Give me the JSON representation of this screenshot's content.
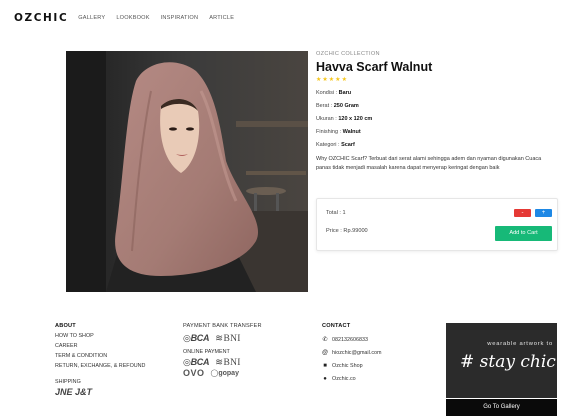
{
  "nav": {
    "logo": "OZCHIC",
    "links": [
      "GALLERY",
      "LOOKBOOK",
      "INSPIRATION",
      "ARTICLE"
    ]
  },
  "product": {
    "collection": "OZCHIC COLLECTION",
    "title": "Havva Scarf Walnut",
    "rating": 5,
    "attributes": [
      {
        "label": "Kondisi : ",
        "value": "Baru"
      },
      {
        "label": "Berat : ",
        "value": "250 Gram"
      },
      {
        "label": "Ukuran : ",
        "value": "120 x 120 cm"
      },
      {
        "label": "Finishing : ",
        "value": "Walnut"
      },
      {
        "label": "Kategori : ",
        "value": "Scarf"
      }
    ],
    "description": "Why OZCHIC Scarf? Terbuat dari serat alami sehingga adem dan nyaman digunakan Cuaca panas tidak menjadi masalah karena dapat menyerap keringat dengan baik"
  },
  "order": {
    "total": "Total : 1",
    "price": "Price : Rp.99000",
    "minus_label": "-",
    "plus_label": "+",
    "cart_label": "Add to Cart"
  },
  "footer": {
    "about": {
      "heading": "ABOUT",
      "items": [
        "HOW TO SHOP",
        "CAREER",
        "TERM & CONDITION",
        "RETURN, EXCHANGE, & REFOUND"
      ],
      "shipping_heading": "SHIPPING",
      "shipping_logo": "JNE J&T"
    },
    "payment": {
      "bank_heading": "PAYMENT BANK TRANSFER",
      "bca": "BCA",
      "bni": "BNI",
      "online_heading": "ONLINE PAYMENT",
      "ovo": "OVO",
      "gopay": "gopay"
    },
    "contact": {
      "heading": "CONTACT",
      "phone": "082132606833",
      "email": "hiozchic@gmail.com",
      "shop": "Ozchic Shop",
      "site": "Ozchic.co"
    },
    "promo": {
      "tagline": "wearable artwork to",
      "script": "# stay chic",
      "button": "Go To Gallery"
    }
  },
  "colors": {
    "accent_green": "#17b978",
    "minus_red": "#e53935",
    "plus_blue": "#1e88e5",
    "star": "#f5c518"
  }
}
